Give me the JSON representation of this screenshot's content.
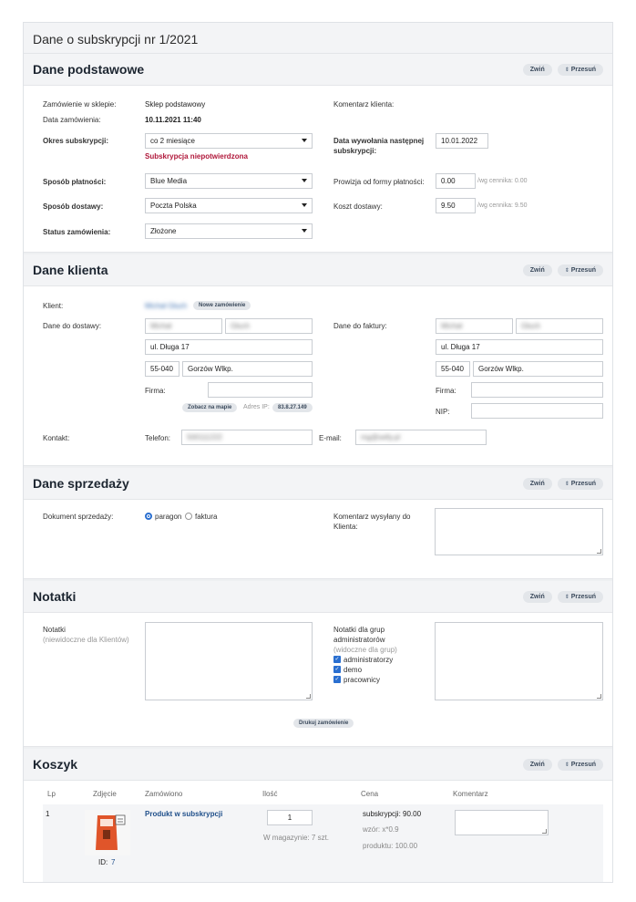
{
  "page_title": "Dane o subskrypcji nr 1/2021",
  "actions": {
    "collapse": "Zwiń",
    "move": "Przesuń"
  },
  "basic": {
    "heading": "Dane podstawowe",
    "shop_label": "Zamówienie w sklepie:",
    "shop_value": "Sklep podstawowy",
    "date_label": "Data zamówienia:",
    "date_value": "10.11.2021 11:40",
    "period_label": "Okres subskrypcji:",
    "period_value": "co 2 miesiące",
    "unconfirmed": "Subskrypcja niepotwierdzona",
    "payment_label": "Sposób płatności:",
    "payment_value": "Blue Media",
    "delivery_label": "Sposób dostawy:",
    "delivery_value": "Poczta Polska",
    "status_label": "Status zamówienia:",
    "status_value": "Złożone",
    "comment_label": "Komentarz klienta:",
    "next_call_label_1": "Data wywołania następnej",
    "next_call_label_2": "subskrypcji:",
    "next_call_value": "10.01.2022",
    "commission_label": "Prowizja od formy płatności:",
    "commission_value": "0.00",
    "commission_hint": "/wg cennika: 0.00",
    "delivery_cost_label": "Koszt dostawy:",
    "delivery_cost_value": "9.50",
    "delivery_cost_hint": "/wg cennika: 9.50"
  },
  "client": {
    "heading": "Dane klienta",
    "client_label": "Klient:",
    "client_name": "Michał Głuch",
    "new_order": "Nowe zamówienie",
    "delivery_label": "Dane do dostawy:",
    "invoice_label": "Dane do faktury:",
    "first_name": "Michał",
    "last_name": "Głuch",
    "street": "ul. Długa 17",
    "zip": "55-040",
    "city": "Gorzów Wlkp.",
    "company_label": "Firma:",
    "nip_label": "NIP:",
    "map_button": "Zobacz na mapie",
    "ip_label": "Adres IP:",
    "ip_value": "83.8.27.149",
    "contact_label": "Kontakt:",
    "phone_label": "Telefon:",
    "phone_value": "500111222",
    "email_label": "E-mail:",
    "email_value": "mg@selly.pl"
  },
  "sales": {
    "heading": "Dane sprzedaży",
    "doc_label": "Dokument sprzedaży:",
    "receipt": "paragon",
    "invoice": "faktura",
    "comment_label_1": "Komentarz wysyłany do",
    "comment_label_2": "Klienta:"
  },
  "notes": {
    "heading": "Notatki",
    "notes_label": "Notatki",
    "notes_sub": "(niewidoczne dla Klientów)",
    "group_label_1": "Notatki dla grup",
    "group_label_2": "administratorów",
    "group_sub": "(widoczne dla grup)",
    "groups": [
      "administratorzy",
      "demo",
      "pracownicy"
    ],
    "print_button": "Drukuj zamówienie"
  },
  "cart": {
    "heading": "Koszyk",
    "columns": [
      "Lp",
      "Zdjęcie",
      "Zamówiono",
      "Ilość",
      "Cena",
      "Komentarz"
    ],
    "row": {
      "lp": "1",
      "id_label": "ID:",
      "id_value": "7",
      "product": "Produkt w subskrypcji",
      "qty": "1",
      "stock": "W magazynie: 7 szt.",
      "price_sub": "subskrypcji: 90.00",
      "price_formula": "wzór: x*0.9",
      "price_product": "produktu: 100.00"
    }
  },
  "colors": {
    "accent": "#2a6fd0",
    "error": "#b0173a",
    "link": "#1f4f8a"
  }
}
